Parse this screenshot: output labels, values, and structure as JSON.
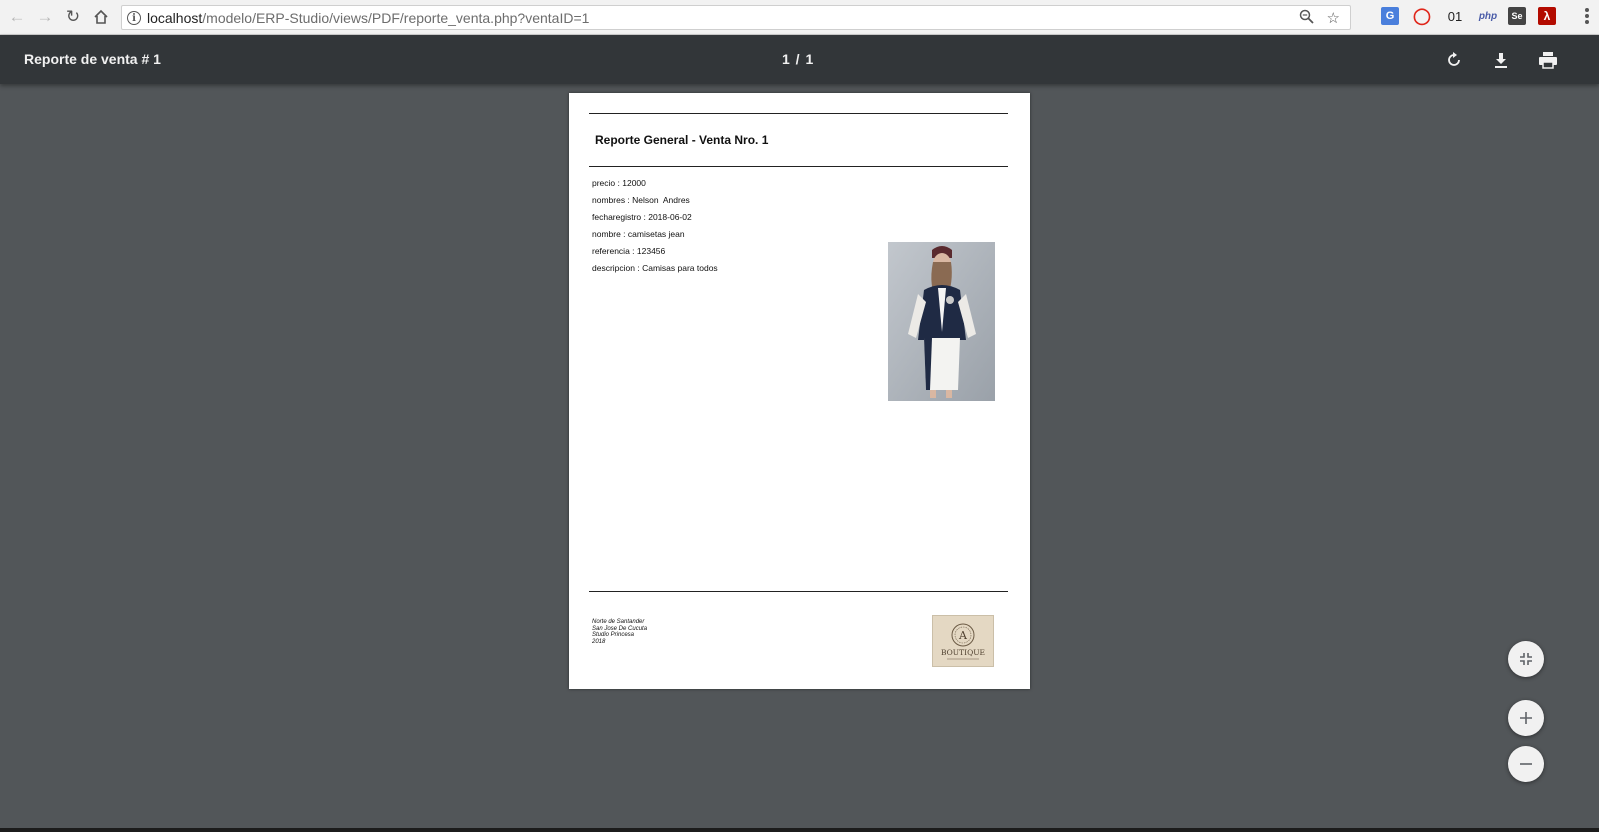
{
  "browser": {
    "url_host": "localhost",
    "url_path": "/modelo/ERP-Studio/views/PDF/reporte_venta.php?ventaID=1",
    "extension_text": "01",
    "extension_php": "php",
    "extension_se": "Se"
  },
  "viewer": {
    "title": "Reporte de venta # 1",
    "page_indicator": "1 / 1"
  },
  "report": {
    "title": "Reporte General - Venta Nro. 1",
    "fields": [
      "precio : 12000",
      "nombres : Nelson  Andres",
      "fecharegistro : 2018-06-02",
      "nombre : camisetas jean",
      "referencia : 123456",
      "descripcion : Camisas para todos"
    ],
    "footer": [
      "Norte de Santander",
      "San Jose De Cucuta",
      "Studio Princesa",
      "2018"
    ],
    "logo_letter": "A",
    "logo_word": "BOUTIQUE"
  },
  "colors": {
    "viewer_bg": "#525659",
    "toolbar_bg": "#323639",
    "chrome_bg": "#f2f2f2"
  }
}
